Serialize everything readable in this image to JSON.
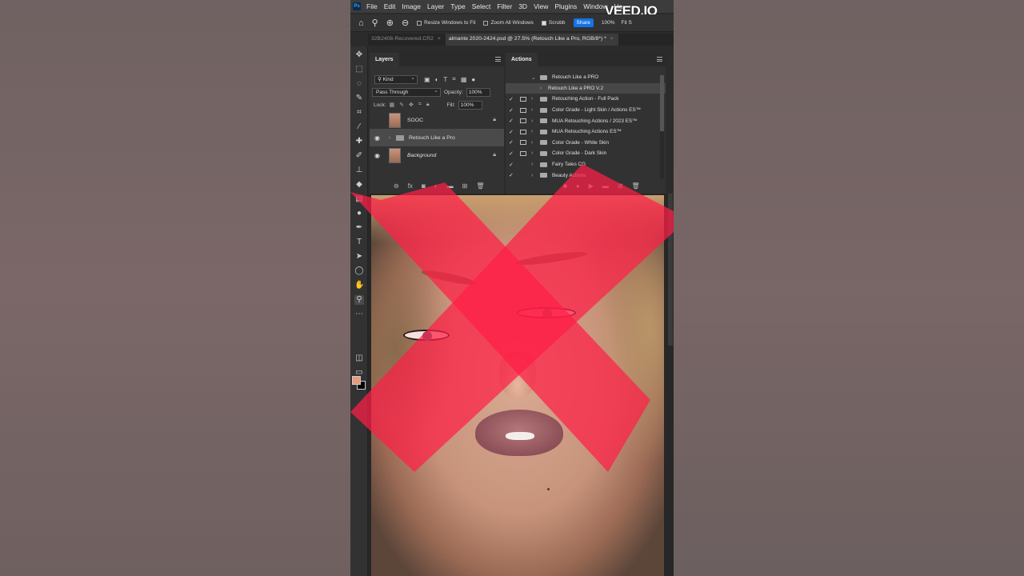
{
  "watermark": "VEED.IO",
  "menubar": {
    "logo": "Ps",
    "items": [
      "File",
      "Edit",
      "Image",
      "Layer",
      "Type",
      "Select",
      "Filter",
      "3D",
      "View",
      "Plugins",
      "Window",
      "He"
    ]
  },
  "options": {
    "resize_windows": "Resize Windows to Fit",
    "zoom_all": "Zoom All Windows",
    "scrubby": "Scrubb",
    "share": "Share",
    "zoom_value": "100%",
    "fit": "Fit S"
  },
  "tabs": [
    {
      "label": "32B2408-Recovered.CR2"
    },
    {
      "label": "almante 2020-2424.psd @ 27.5% (Retouch Like a Pro, RGB/8*) *"
    }
  ],
  "layers_panel": {
    "title": "Layers",
    "kind": "Kind",
    "blend_mode": "Pass Through",
    "opacity_label": "Opacity:",
    "opacity": "100%",
    "lock_label": "Lock:",
    "fill_label": "Fill:",
    "fill": "100%",
    "layers": [
      {
        "name": "SOOC"
      },
      {
        "name": "Retouch Like a Pro"
      },
      {
        "name": "Background"
      }
    ]
  },
  "actions_panel": {
    "title": "Actions",
    "items": [
      {
        "name": "Retouch Like a PRO"
      },
      {
        "name": "Retouch Like a PRO V.2"
      },
      {
        "name": "Retouching Action - Full Pack"
      },
      {
        "name": "Color Grade - Light Skin / Actions ES™"
      },
      {
        "name": "MUA Retouching Actions / 2023 ES™"
      },
      {
        "name": "MUA Retouching Actions ES™"
      },
      {
        "name": "Color Grade - White Skin"
      },
      {
        "name": "Color Grade - Dark Skin"
      },
      {
        "name": "Fairy Tales CG"
      },
      {
        "name": "Beauty Actions"
      }
    ]
  },
  "colors": {
    "foreground": "#e79a7e",
    "background": "#000000",
    "x_overlay": "#ff1e46",
    "share_blue": "#1473e6"
  },
  "icons": [
    "home-icon",
    "zoom-tool-icon",
    "zoom-in-icon",
    "zoom-out-icon",
    "move-icon",
    "marquee-icon",
    "lasso-icon",
    "quick-select-icon",
    "crop-icon",
    "eyedropper-icon",
    "healing-icon",
    "brush-icon",
    "stamp-icon",
    "eraser-icon",
    "gradient-icon",
    "blur-icon",
    "pen-icon",
    "type-icon",
    "path-select-icon",
    "ellipse-icon",
    "hand-icon",
    "zoom-icon",
    "more-tools-icon",
    "eye-icon",
    "lock-icon",
    "folder-icon",
    "check-icon"
  ]
}
